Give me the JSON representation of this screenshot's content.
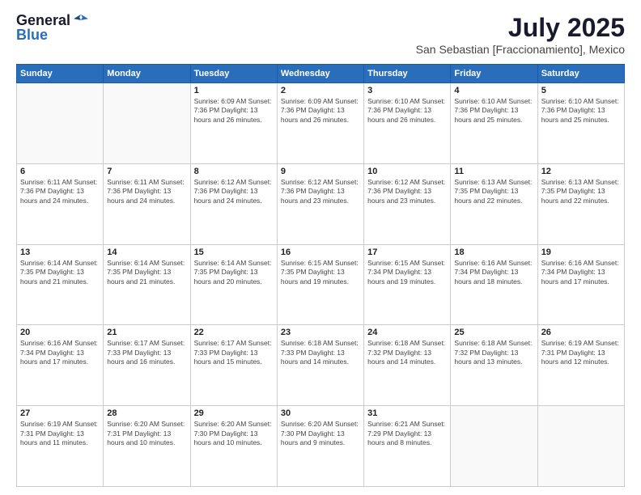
{
  "logo": {
    "general": "General",
    "blue": "Blue"
  },
  "title": "July 2025",
  "subtitle": "San Sebastian [Fraccionamiento], Mexico",
  "weekdays": [
    "Sunday",
    "Monday",
    "Tuesday",
    "Wednesday",
    "Thursday",
    "Friday",
    "Saturday"
  ],
  "weeks": [
    [
      {
        "day": "",
        "info": ""
      },
      {
        "day": "",
        "info": ""
      },
      {
        "day": "1",
        "info": "Sunrise: 6:09 AM\nSunset: 7:36 PM\nDaylight: 13 hours and 26 minutes."
      },
      {
        "day": "2",
        "info": "Sunrise: 6:09 AM\nSunset: 7:36 PM\nDaylight: 13 hours and 26 minutes."
      },
      {
        "day": "3",
        "info": "Sunrise: 6:10 AM\nSunset: 7:36 PM\nDaylight: 13 hours and 26 minutes."
      },
      {
        "day": "4",
        "info": "Sunrise: 6:10 AM\nSunset: 7:36 PM\nDaylight: 13 hours and 25 minutes."
      },
      {
        "day": "5",
        "info": "Sunrise: 6:10 AM\nSunset: 7:36 PM\nDaylight: 13 hours and 25 minutes."
      }
    ],
    [
      {
        "day": "6",
        "info": "Sunrise: 6:11 AM\nSunset: 7:36 PM\nDaylight: 13 hours and 24 minutes."
      },
      {
        "day": "7",
        "info": "Sunrise: 6:11 AM\nSunset: 7:36 PM\nDaylight: 13 hours and 24 minutes."
      },
      {
        "day": "8",
        "info": "Sunrise: 6:12 AM\nSunset: 7:36 PM\nDaylight: 13 hours and 24 minutes."
      },
      {
        "day": "9",
        "info": "Sunrise: 6:12 AM\nSunset: 7:36 PM\nDaylight: 13 hours and 23 minutes."
      },
      {
        "day": "10",
        "info": "Sunrise: 6:12 AM\nSunset: 7:36 PM\nDaylight: 13 hours and 23 minutes."
      },
      {
        "day": "11",
        "info": "Sunrise: 6:13 AM\nSunset: 7:35 PM\nDaylight: 13 hours and 22 minutes."
      },
      {
        "day": "12",
        "info": "Sunrise: 6:13 AM\nSunset: 7:35 PM\nDaylight: 13 hours and 22 minutes."
      }
    ],
    [
      {
        "day": "13",
        "info": "Sunrise: 6:14 AM\nSunset: 7:35 PM\nDaylight: 13 hours and 21 minutes."
      },
      {
        "day": "14",
        "info": "Sunrise: 6:14 AM\nSunset: 7:35 PM\nDaylight: 13 hours and 21 minutes."
      },
      {
        "day": "15",
        "info": "Sunrise: 6:14 AM\nSunset: 7:35 PM\nDaylight: 13 hours and 20 minutes."
      },
      {
        "day": "16",
        "info": "Sunrise: 6:15 AM\nSunset: 7:35 PM\nDaylight: 13 hours and 19 minutes."
      },
      {
        "day": "17",
        "info": "Sunrise: 6:15 AM\nSunset: 7:34 PM\nDaylight: 13 hours and 19 minutes."
      },
      {
        "day": "18",
        "info": "Sunrise: 6:16 AM\nSunset: 7:34 PM\nDaylight: 13 hours and 18 minutes."
      },
      {
        "day": "19",
        "info": "Sunrise: 6:16 AM\nSunset: 7:34 PM\nDaylight: 13 hours and 17 minutes."
      }
    ],
    [
      {
        "day": "20",
        "info": "Sunrise: 6:16 AM\nSunset: 7:34 PM\nDaylight: 13 hours and 17 minutes."
      },
      {
        "day": "21",
        "info": "Sunrise: 6:17 AM\nSunset: 7:33 PM\nDaylight: 13 hours and 16 minutes."
      },
      {
        "day": "22",
        "info": "Sunrise: 6:17 AM\nSunset: 7:33 PM\nDaylight: 13 hours and 15 minutes."
      },
      {
        "day": "23",
        "info": "Sunrise: 6:18 AM\nSunset: 7:33 PM\nDaylight: 13 hours and 14 minutes."
      },
      {
        "day": "24",
        "info": "Sunrise: 6:18 AM\nSunset: 7:32 PM\nDaylight: 13 hours and 14 minutes."
      },
      {
        "day": "25",
        "info": "Sunrise: 6:18 AM\nSunset: 7:32 PM\nDaylight: 13 hours and 13 minutes."
      },
      {
        "day": "26",
        "info": "Sunrise: 6:19 AM\nSunset: 7:31 PM\nDaylight: 13 hours and 12 minutes."
      }
    ],
    [
      {
        "day": "27",
        "info": "Sunrise: 6:19 AM\nSunset: 7:31 PM\nDaylight: 13 hours and 11 minutes."
      },
      {
        "day": "28",
        "info": "Sunrise: 6:20 AM\nSunset: 7:31 PM\nDaylight: 13 hours and 10 minutes."
      },
      {
        "day": "29",
        "info": "Sunrise: 6:20 AM\nSunset: 7:30 PM\nDaylight: 13 hours and 10 minutes."
      },
      {
        "day": "30",
        "info": "Sunrise: 6:20 AM\nSunset: 7:30 PM\nDaylight: 13 hours and 9 minutes."
      },
      {
        "day": "31",
        "info": "Sunrise: 6:21 AM\nSunset: 7:29 PM\nDaylight: 13 hours and 8 minutes."
      },
      {
        "day": "",
        "info": ""
      },
      {
        "day": "",
        "info": ""
      }
    ]
  ]
}
